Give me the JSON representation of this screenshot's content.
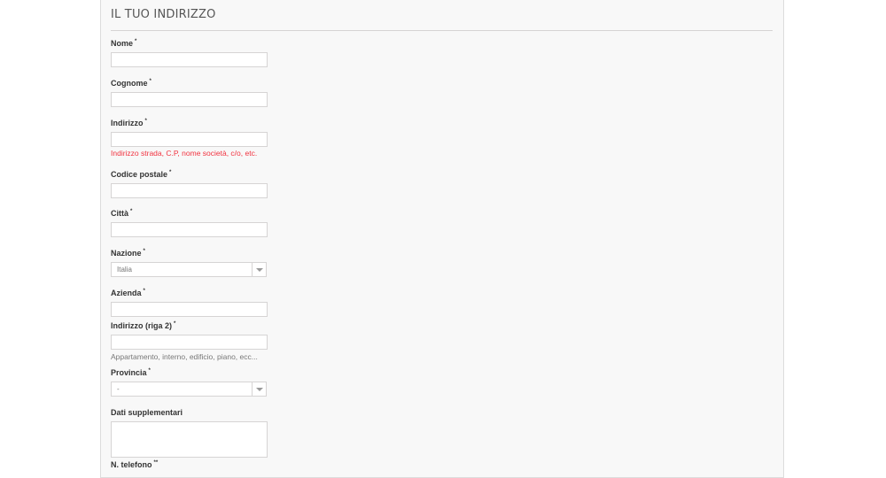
{
  "section_title": "IL TUO INDIRIZZO",
  "fields": {
    "nome": {
      "label": "Nome",
      "marker": "*",
      "value": ""
    },
    "cognome": {
      "label": "Cognome",
      "marker": "*",
      "value": ""
    },
    "indirizzo": {
      "label": "Indirizzo",
      "marker": "*",
      "value": "",
      "hint": "Indirizzo strada, C.P, nome società, c/o, etc."
    },
    "codice_postale": {
      "label": "Codice postale",
      "marker": "*",
      "value": ""
    },
    "citta": {
      "label": "Città",
      "marker": "*",
      "value": ""
    },
    "nazione": {
      "label": "Nazione",
      "marker": "*",
      "selected": "Italia"
    },
    "azienda": {
      "label": "Azienda",
      "marker": "*",
      "value": ""
    },
    "indirizzo2": {
      "label": "Indirizzo (riga 2)",
      "marker": "*",
      "value": "",
      "hint": "Appartamento, interno, edificio, piano, ecc..."
    },
    "provincia": {
      "label": "Provincia",
      "marker": "*",
      "selected": "-"
    },
    "dati_supplementari": {
      "label": "Dati supplementari",
      "value": ""
    },
    "telefono": {
      "label": "N. telefono",
      "marker": "**"
    }
  },
  "colors": {
    "hint_error": "#f13340",
    "panel_bg": "#f8f8f8"
  }
}
